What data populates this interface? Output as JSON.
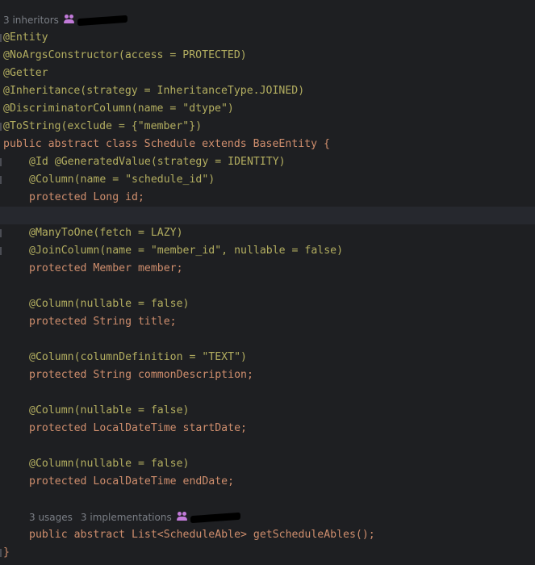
{
  "class_inlay": {
    "inheritors": "3 inheritors"
  },
  "method_inlay": {
    "usages": "3 usages",
    "implementations": "3 implementations"
  },
  "code_lines": [
    "@Entity",
    "@NoArgsConstructor(access = PROTECTED)",
    "@Getter",
    "@Inheritance(strategy = InheritanceType.JOINED)",
    "@DiscriminatorColumn(name = \"dtype\")",
    "@ToString(exclude = {\"member\"})",
    "public abstract class Schedule extends BaseEntity {",
    "@Id @GeneratedValue(strategy = IDENTITY)",
    "@Column(name = \"schedule_id\")",
    "protected Long id;",
    "",
    "@ManyToOne(fetch = LAZY)",
    "@JoinColumn(name = \"member_id\", nullable = false)",
    "protected Member member;",
    "",
    "@Column(nullable = false)",
    "protected String title;",
    "",
    "@Column(columnDefinition = \"TEXT\")",
    "protected String commonDescription;",
    "",
    "@Column(nullable = false)",
    "protected LocalDateTime startDate;",
    "",
    "@Column(nullable = false)",
    "protected LocalDateTime endDate;",
    "",
    "public abstract List<ScheduleAble> getScheduleAbles();",
    "}"
  ],
  "colors": {
    "background": "#1e1f22",
    "current_line": "#26282e",
    "annotation": "#b3ae60",
    "keyword": "#cf8e6d",
    "string": "#6aab73",
    "field": "#c77dbb",
    "method": "#56a8f5",
    "text": "#bcbec4",
    "inlay": "#7a7e85"
  }
}
